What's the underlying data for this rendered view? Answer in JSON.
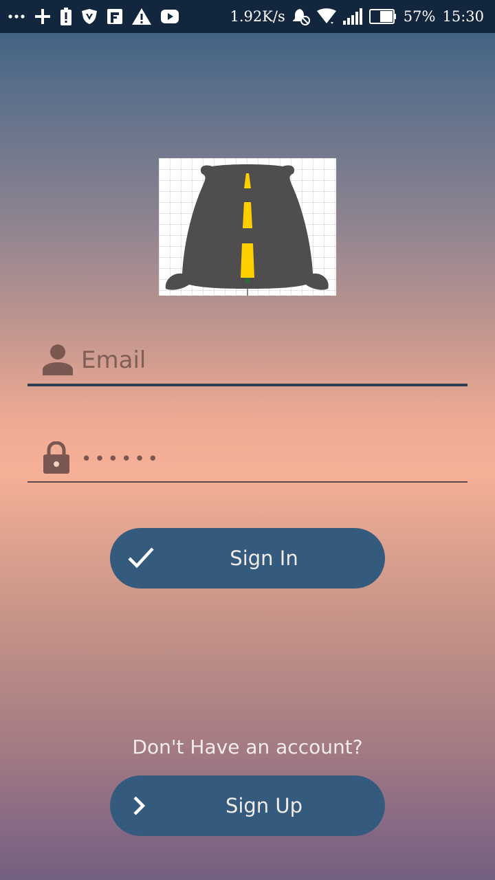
{
  "status_bar": {
    "net_speed": "1.92K/s",
    "battery_percent": "57%",
    "time": "15:30",
    "left_icons": [
      "more-dots-icon",
      "plus-icon",
      "battery-alert-icon",
      "shield-v-icon",
      "flipboard-icon",
      "warning-icon",
      "youtube-icon"
    ],
    "right_icons": [
      "alarm-off-icon",
      "wifi-icon",
      "signal-icon",
      "battery-icon"
    ]
  },
  "logo": {
    "icon": "road-logo-icon",
    "colors": {
      "body": "#4f4d4d",
      "stripe": "#ffd000"
    }
  },
  "form": {
    "email": {
      "placeholder": "Email",
      "value": ""
    },
    "password": {
      "value": "••••••"
    }
  },
  "sign_in": {
    "label": "Sign In"
  },
  "signup_prompt": "Don't Have an account?",
  "sign_up": {
    "label": "Sign Up"
  },
  "colors": {
    "status_bar": "#12263d",
    "button": "#345b7d",
    "underline": "#2f3e52"
  }
}
